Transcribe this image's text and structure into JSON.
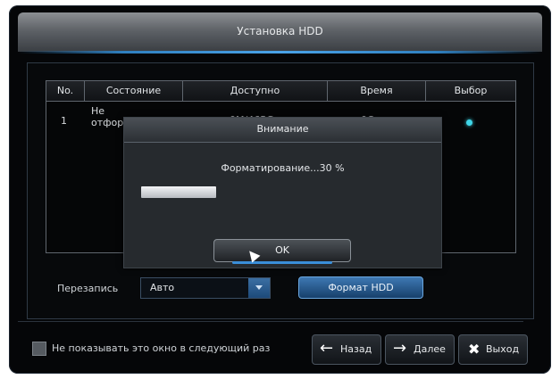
{
  "window": {
    "title": "Установка HDD"
  },
  "table": {
    "columns": [
      "No.",
      "Состояние",
      "Доступно",
      "Время",
      "Выбор"
    ],
    "rows": [
      {
        "no": "1",
        "status": "Не отформат",
        "available": "0M/465G",
        "time": "0Сек"
      }
    ]
  },
  "overwrite": {
    "label": "Перезапись",
    "value": "Авто"
  },
  "format_button": "Формат HDD",
  "bottom": {
    "checkbox_label": "Не показывать это окно в следующий раз",
    "back": "Назад",
    "next": "Далее",
    "exit": "Выход"
  },
  "dialog": {
    "title": "Внимание",
    "message": "Форматирование...30 %",
    "progress": 0.3,
    "ok": "OK"
  },
  "colors": {
    "accent": "#3a8ed8",
    "selection_dot": "#3fd6e8"
  },
  "icons": {
    "back": "arrow-left-icon",
    "next": "arrow-right-icon",
    "exit": "close-icon",
    "combo": "chevron-down-icon"
  }
}
